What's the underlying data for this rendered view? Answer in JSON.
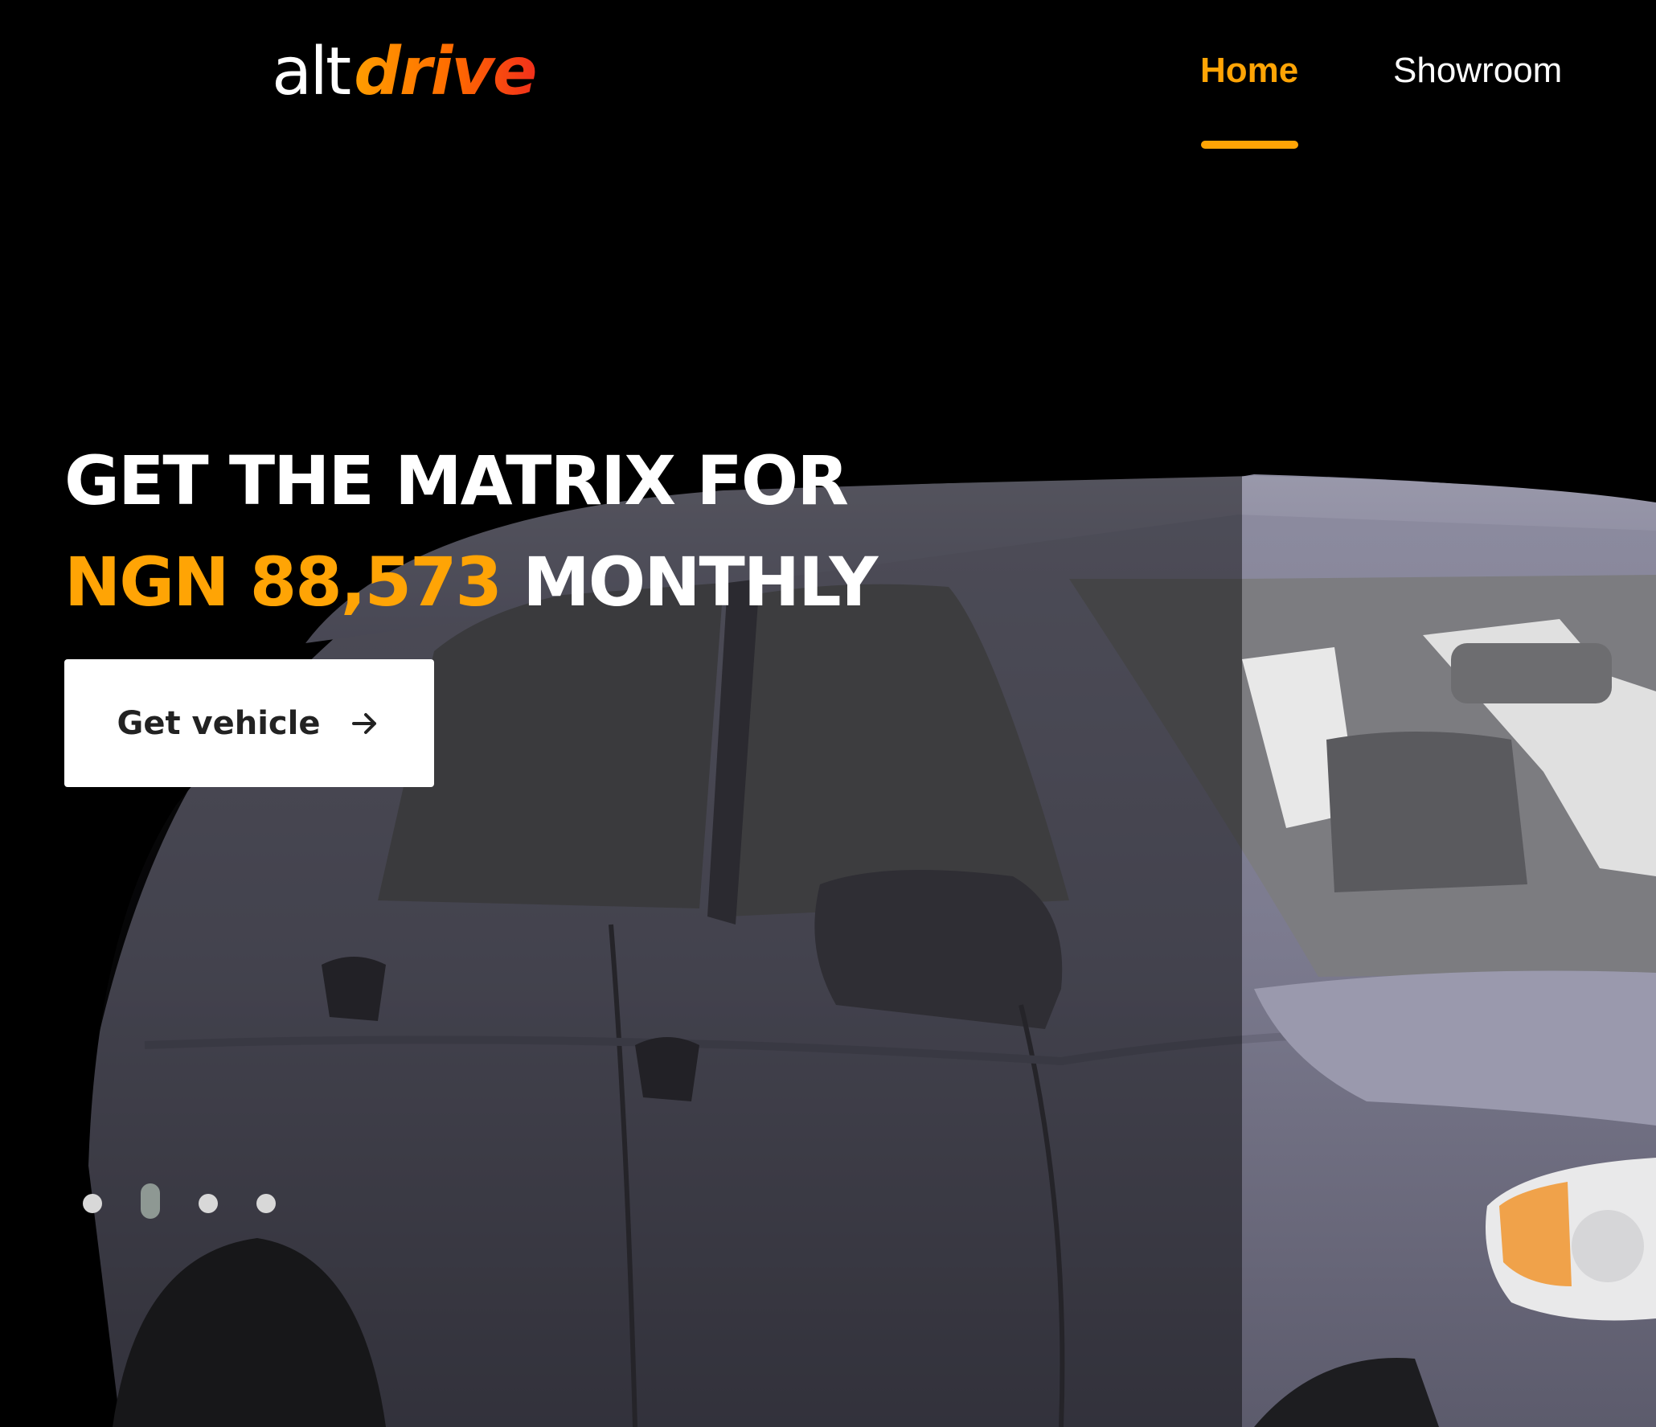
{
  "header": {
    "logo": {
      "alt": "alt",
      "drive": "drive"
    },
    "nav": [
      {
        "label": "Home",
        "active": true
      },
      {
        "label": "Showroom",
        "active": false
      }
    ]
  },
  "hero": {
    "headline_line1": "GET THE MATRIX FOR",
    "price": "NGN 88,573",
    "period": "MONTHLY",
    "cta_label": "Get vehicle",
    "cta_icon": "arrow-right-icon",
    "image": "car-image"
  },
  "carousel": {
    "slide_count": 4,
    "active_index": 1
  },
  "colors": {
    "background": "#000000",
    "accent": "#FFA405",
    "logo_gradient_end": "#F2301B",
    "button_bg": "#FFFFFF",
    "button_text": "#222222"
  }
}
